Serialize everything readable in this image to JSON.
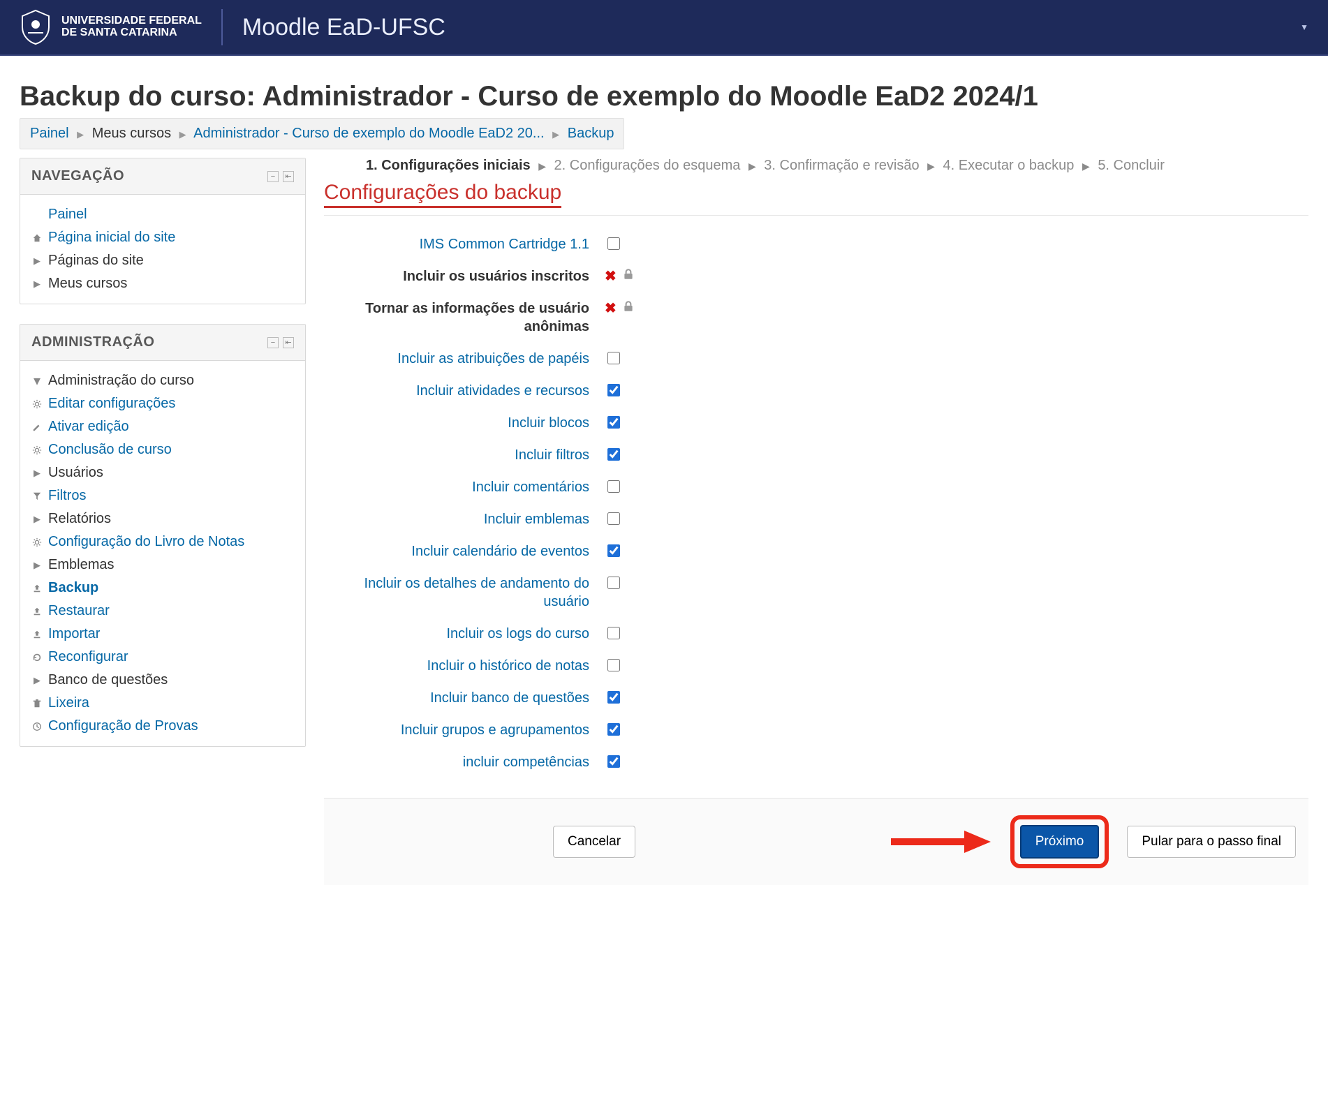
{
  "header": {
    "brand_line1": "UNIVERSIDADE FEDERAL",
    "brand_line2": "DE SANTA CATARINA",
    "site_title": "Moodle EaD-UFSC"
  },
  "page_title": "Backup do curso: Administrador - Curso de exemplo do Moodle EaD2 2024/1",
  "breadcrumb": {
    "painel": "Painel",
    "meus_cursos": "Meus cursos",
    "course": "Administrador - Curso de exemplo do Moodle EaD2 20...",
    "backup": "Backup"
  },
  "nav_block": {
    "title": "NAVEGAÇÃO",
    "items": [
      {
        "label": "Painel",
        "link": true,
        "level": 1,
        "icon": ""
      },
      {
        "label": "Página inicial do site",
        "link": true,
        "level": 1,
        "icon": "home"
      },
      {
        "label": "Páginas do site",
        "link": false,
        "level": 1,
        "icon": "caret"
      },
      {
        "label": "Meus cursos",
        "link": false,
        "level": 1,
        "icon": "caret"
      }
    ]
  },
  "admin_block": {
    "title": "ADMINISTRAÇÃO",
    "root": "Administração do curso",
    "items": [
      {
        "label": "Editar configurações",
        "icon": "gear",
        "link": true
      },
      {
        "label": "Ativar edição",
        "icon": "pencil",
        "link": true
      },
      {
        "label": "Conclusão de curso",
        "icon": "gear",
        "link": true
      },
      {
        "label": "Usuários",
        "icon": "caret",
        "link": false
      },
      {
        "label": "Filtros",
        "icon": "funnel",
        "link": true
      },
      {
        "label": "Relatórios",
        "icon": "caret",
        "link": false
      },
      {
        "label": "Configuração do Livro de Notas",
        "icon": "gear",
        "link": true
      },
      {
        "label": "Emblemas",
        "icon": "caret",
        "link": false
      },
      {
        "label": "Backup",
        "icon": "upload",
        "link": true,
        "bold": true
      },
      {
        "label": "Restaurar",
        "icon": "upload",
        "link": true
      },
      {
        "label": "Importar",
        "icon": "upload",
        "link": true
      },
      {
        "label": "Reconfigurar",
        "icon": "reset",
        "link": true
      },
      {
        "label": "Banco de questões",
        "icon": "caret",
        "link": false
      },
      {
        "label": "Lixeira",
        "icon": "trash",
        "link": true
      },
      {
        "label": "Configuração de Provas",
        "icon": "clock",
        "link": true
      }
    ]
  },
  "steps": {
    "s1": "1. Configurações iniciais",
    "s2": "2. Configurações do esquema",
    "s3": "3. Confirmação e revisão",
    "s4": "4. Executar o backup",
    "s5": "5. Concluir"
  },
  "section_title": "Configurações do backup",
  "settings": [
    {
      "label": "IMS Common Cartridge 1.1",
      "type": "checkbox",
      "checked": false
    },
    {
      "label": "Incluir os usuários inscritos",
      "type": "locked",
      "bold": true
    },
    {
      "label": "Tornar as informações de usuário anônimas",
      "type": "locked",
      "bold": true
    },
    {
      "label": "Incluir as atribuições de papéis",
      "type": "checkbox",
      "checked": false
    },
    {
      "label": "Incluir atividades e recursos",
      "type": "checkbox",
      "checked": true
    },
    {
      "label": "Incluir blocos",
      "type": "checkbox",
      "checked": true
    },
    {
      "label": "Incluir filtros",
      "type": "checkbox",
      "checked": true
    },
    {
      "label": "Incluir comentários",
      "type": "checkbox",
      "checked": false
    },
    {
      "label": "Incluir emblemas",
      "type": "checkbox",
      "checked": false
    },
    {
      "label": "Incluir calendário de eventos",
      "type": "checkbox",
      "checked": true
    },
    {
      "label": "Incluir os detalhes de andamento do usuário",
      "type": "checkbox",
      "checked": false
    },
    {
      "label": "Incluir os logs do curso",
      "type": "checkbox",
      "checked": false
    },
    {
      "label": "Incluir o histórico de notas",
      "type": "checkbox",
      "checked": false
    },
    {
      "label": "Incluir banco de questões",
      "type": "checkbox",
      "checked": true
    },
    {
      "label": "Incluir grupos e agrupamentos",
      "type": "checkbox",
      "checked": true
    },
    {
      "label": "incluir competências",
      "type": "checkbox",
      "checked": true
    }
  ],
  "actions": {
    "cancel": "Cancelar",
    "next": "Próximo",
    "skip": "Pular para o passo final"
  }
}
